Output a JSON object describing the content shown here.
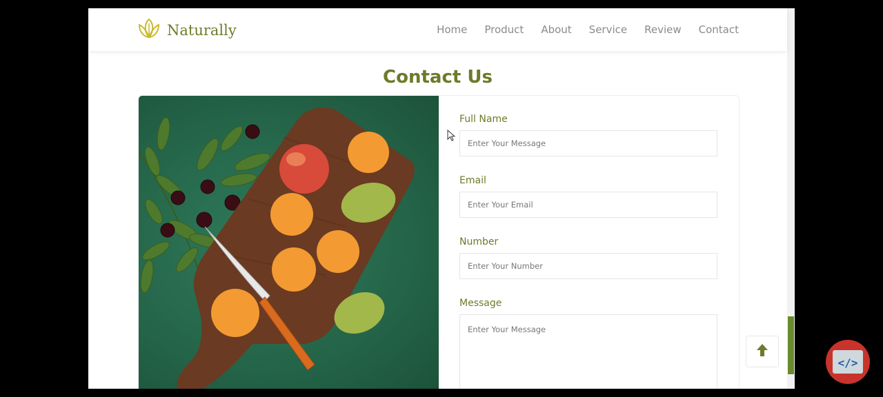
{
  "brand": {
    "name": "Naturally",
    "icon": "leaf-logo-icon"
  },
  "nav": {
    "links": [
      "Home",
      "Product",
      "About",
      "Service",
      "Review",
      "Contact"
    ]
  },
  "page": {
    "heading": "Contact Us"
  },
  "form": {
    "fields": [
      {
        "label": "Full Name",
        "placeholder": "Enter Your Message"
      },
      {
        "label": "Email",
        "placeholder": "Enter Your Email"
      },
      {
        "label": "Number",
        "placeholder": "Enter Your Number"
      },
      {
        "label": "Message",
        "placeholder": "Enter Your Message"
      }
    ]
  },
  "scroll_top": {
    "icon": "arrow-up-icon"
  },
  "overlay": {
    "icon": "code-icon",
    "text": "</>"
  },
  "colors": {
    "accent": "#6e7a2a",
    "scroll_accent": "#6b8a2e",
    "overlay_red": "#c8342b"
  }
}
